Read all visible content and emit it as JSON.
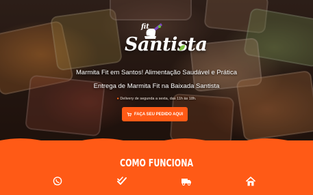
{
  "brand": {
    "logo_text": "Santista",
    "logo_top": "fit"
  },
  "hero": {
    "line1": "Marmita Fit em Santos! Alimentação Saudável e Prática",
    "line2": "Entrega de Marmita Fit na Baixada Santista",
    "delivery": "Delivery de segunda a sexta, das 11h às 18h.",
    "cta_label": "FAÇA SEU PEDIDO AQUI"
  },
  "how_it_works": {
    "title": "COMO FUNCIONA",
    "steps": [
      {
        "icon": "whatsapp-icon"
      },
      {
        "icon": "double-check-icon"
      },
      {
        "icon": "delivery-truck-icon"
      },
      {
        "icon": "home-icon"
      }
    ]
  },
  "colors": {
    "accent": "#ff5a16",
    "hero_bg": "#2b1d16",
    "text": "#ffffff"
  }
}
